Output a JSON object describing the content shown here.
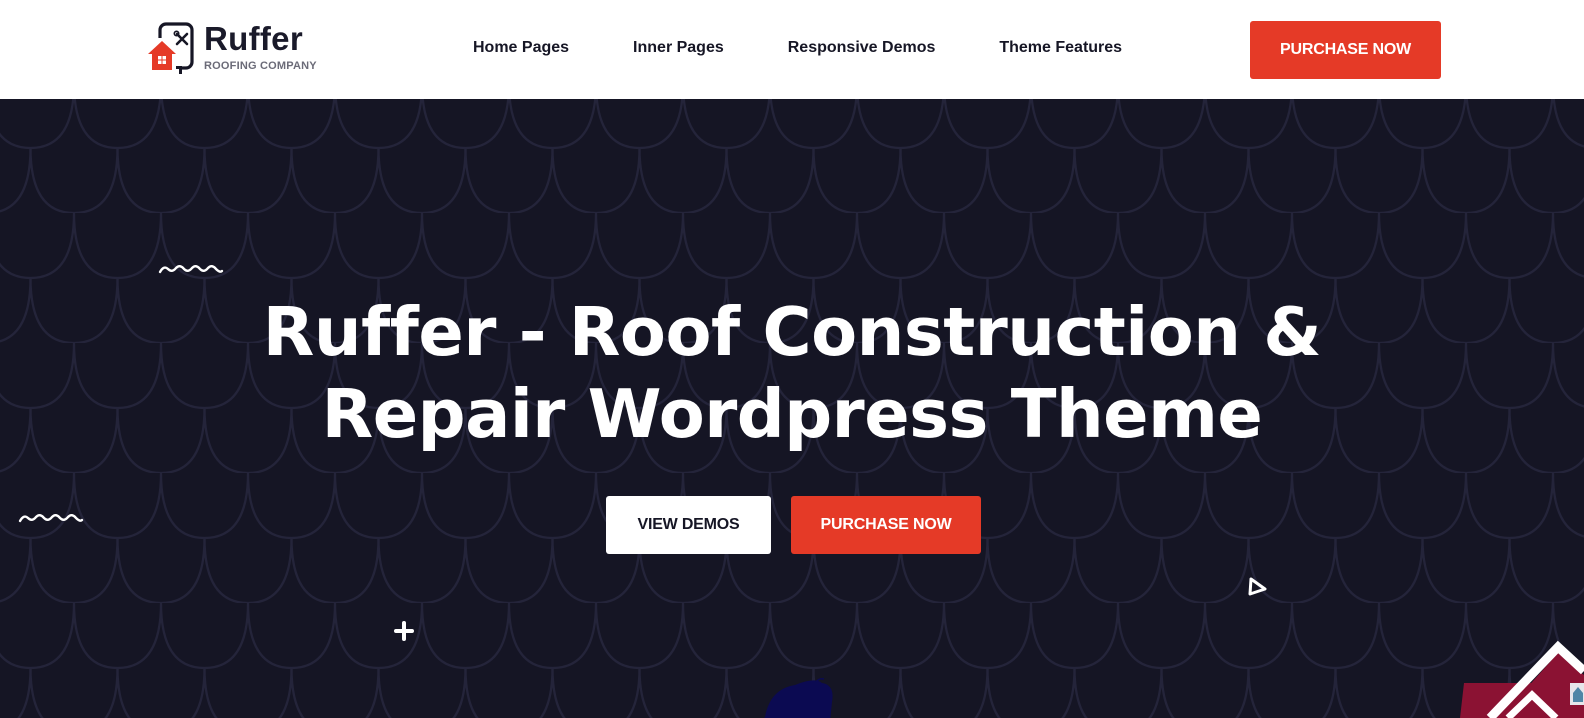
{
  "brand": {
    "name": "Ruffer",
    "tagline": "ROOFING COMPANY",
    "logo_icon": "house-tools-logo-icon",
    "colors": {
      "accent": "#e53a27",
      "dark": "#151524",
      "text": "#161625"
    }
  },
  "nav": {
    "items": [
      {
        "label": "Home Pages"
      },
      {
        "label": "Inner Pages"
      },
      {
        "label": "Responsive Demos"
      },
      {
        "label": "Theme Features"
      }
    ],
    "cta_label": "PURCHASE NOW"
  },
  "hero": {
    "title_line1": "Ruffer - Roof Construction &",
    "title_line2": "Repair Wordpress Theme",
    "view_demos_label": "VIEW DEMOS",
    "purchase_label": "PURCHASE NOW",
    "decorations": [
      "zigzag-icon",
      "zigzag-icon",
      "plus-icon",
      "triangle-icon",
      "blob-shape",
      "house-illustration"
    ]
  }
}
